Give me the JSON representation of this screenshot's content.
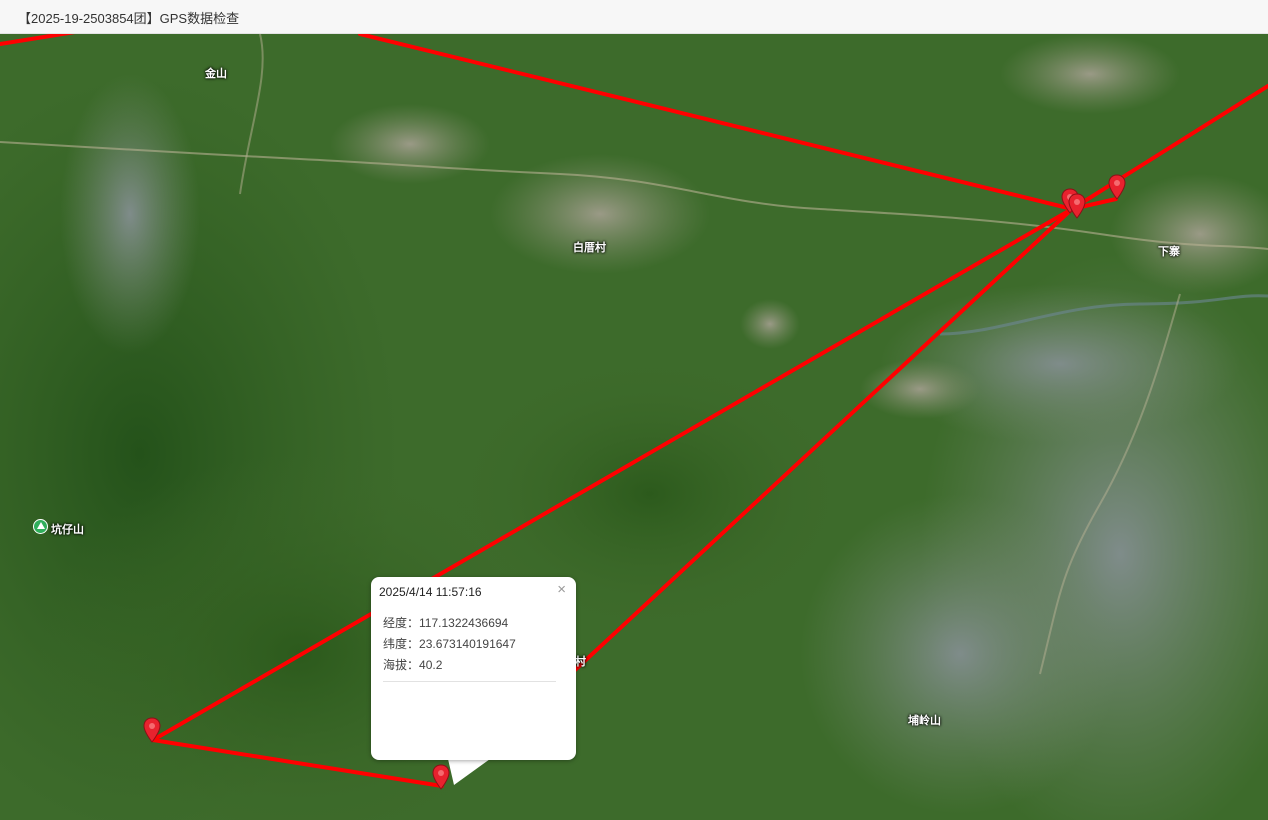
{
  "header": {
    "title": "【2025-19-2503854团】GPS数据检查"
  },
  "map": {
    "place_labels": [
      {
        "id": "jinshan",
        "text": "金山"
      },
      {
        "id": "baicuocun",
        "text": "白厝村"
      },
      {
        "id": "xiazhai",
        "text": "下寨"
      },
      {
        "id": "kengzaishan",
        "text": "坑仔山"
      },
      {
        "id": "cun",
        "text": "村"
      },
      {
        "id": "pulingshan",
        "text": "埔岭山"
      }
    ],
    "track_color": "#ff0000",
    "marker_color": "#e8222e",
    "peak_icon_color": "#2fae5a"
  },
  "popup": {
    "title": "2025/4/14 11:57:16",
    "longitude_label": "经度：",
    "longitude_value": "117.1322436694",
    "latitude_label": "纬度：",
    "latitude_value": "23.673140191647",
    "altitude_label": "海拔：",
    "altitude_value": "40.2",
    "close_glyph": "×"
  }
}
